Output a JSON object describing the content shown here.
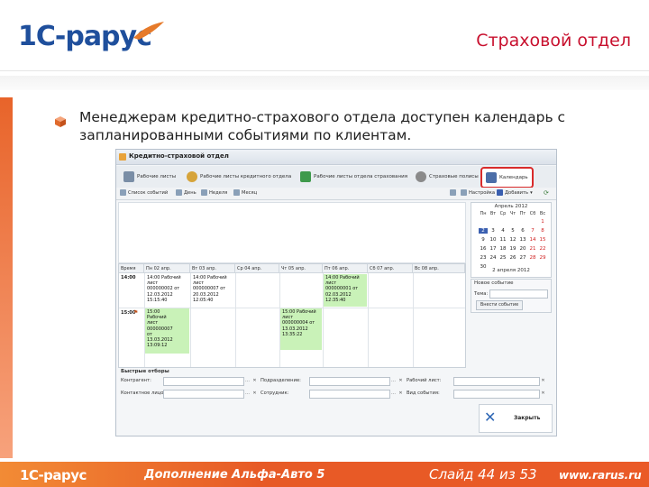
{
  "header": {
    "logo_text": "1С-рарус",
    "title": "Страховой отдел"
  },
  "content": {
    "bullet_text": "Менеджерам кредитно-страхового отдела доступен календарь с запланированными событиями по клиентам."
  },
  "app": {
    "title": "Кредитно-страховой отдел",
    "tabs": [
      {
        "label": "Рабочие листы",
        "icon": "sheets-icon",
        "color": "#7a8ea6"
      },
      {
        "label": "Рабочие листы кредитного отдела",
        "icon": "coins-icon",
        "color": "#d6a43a"
      },
      {
        "label": "Рабочие листы отдела страхования",
        "icon": "book-icon",
        "color": "#3f9a4c"
      },
      {
        "label": "Страховые полисы",
        "icon": "person-icon",
        "color": "#8a8a8a"
      },
      {
        "label": "Календарь",
        "icon": "calendar-icon",
        "color": "#4c6ea8"
      }
    ],
    "toolbar": {
      "list": "Список событий",
      "day": "День",
      "week": "Неделя",
      "month": "Месяц",
      "settings": "Настройка",
      "add": "Добавить"
    },
    "grid": {
      "time_header": "Время",
      "days": [
        "Пн 02 апр.",
        "Вт 03 апр.",
        "Ср 04 апр.",
        "Чт 05 апр.",
        "Пт 06 апр.",
        "Сб 07 апр.",
        "Вс 08 апр."
      ],
      "times": [
        "14:00",
        "15:00"
      ],
      "events": [
        {
          "day": 0,
          "slot": 0,
          "style": "white",
          "text": "14:00 Рабочий\nлист\n000000002 от\n12.03.2012\n15:15:40"
        },
        {
          "day": 1,
          "slot": 0,
          "style": "white",
          "text": "14:00 Рабочий\nлист\n000000007 от\n20.03.2012\n12:05:40"
        },
        {
          "day": 4,
          "slot": 0,
          "style": "green",
          "text": "14:00 Рабочий\nлист\n000000001 от\n02.03.2012\n12:35:40"
        },
        {
          "day": 0,
          "slot": 1,
          "style": "green",
          "text": "15:00\nРабочий\nлист\n000000007\nот\n13.03.2012\n13:09:12"
        },
        {
          "day": 3,
          "slot": 1,
          "style": "green",
          "text": "15:00 Рабочий\nлист\n000000004 от\n13.03.2012\n13:35:22"
        }
      ]
    },
    "mini_calendar": {
      "month": "Апрель 2012",
      "weekdays": [
        "Пн",
        "Вт",
        "Ср",
        "Чт",
        "Пт",
        "Сб",
        "Вс"
      ],
      "weeks": [
        [
          "",
          "",
          "",
          "",
          "",
          "",
          "1"
        ],
        [
          "2",
          "3",
          "4",
          "5",
          "6",
          "7",
          "8"
        ],
        [
          "9",
          "10",
          "11",
          "12",
          "13",
          "14",
          "15"
        ],
        [
          "16",
          "17",
          "18",
          "19",
          "20",
          "21",
          "22"
        ],
        [
          "23",
          "24",
          "25",
          "26",
          "27",
          "28",
          "29"
        ],
        [
          "30",
          "",
          "",
          "",
          "",
          "",
          ""
        ]
      ],
      "today": "2",
      "footer": "2 апреля 2012"
    },
    "new_event": {
      "title": "Новое событие",
      "topic_label": "Тема:",
      "button": "Внести событие"
    },
    "filters": {
      "title": "Быстрые отборы",
      "counterparty": "Контрагент:",
      "department": "Подразделение:",
      "worksheet": "Рабочий лист:",
      "contact": "Контактное лицо:",
      "employee": "Сотрудник:",
      "event_type": "Вид события:"
    },
    "close_label": "Закрыть"
  },
  "footer": {
    "logo": "1С-рарус",
    "doc": "Дополнение Альфа-Авто 5",
    "slide": "Слайд 44 из 53",
    "url": "www.rarus.ru"
  }
}
